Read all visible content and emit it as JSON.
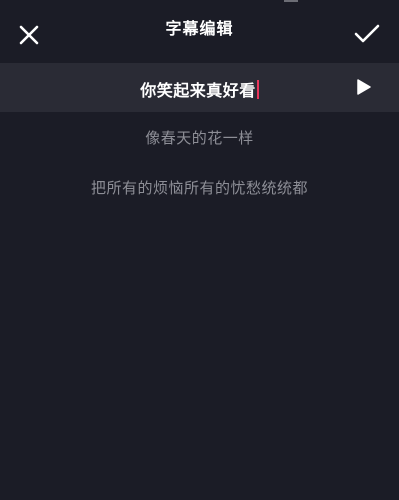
{
  "header": {
    "title": "字幕编辑",
    "close_icon": "close-icon",
    "confirm_icon": "checkmark-icon"
  },
  "subtitles": {
    "active": "你笑起来真好看",
    "lines": [
      "像春天的花一样",
      "把所有的烦恼所有的忧愁统统都"
    ],
    "play_icon": "play-icon"
  },
  "colors": {
    "background": "#1b1c26",
    "active_row": "#2a2b35",
    "text_primary": "#ffffff",
    "text_secondary": "#8d8e96",
    "cursor": "#e8345a"
  }
}
